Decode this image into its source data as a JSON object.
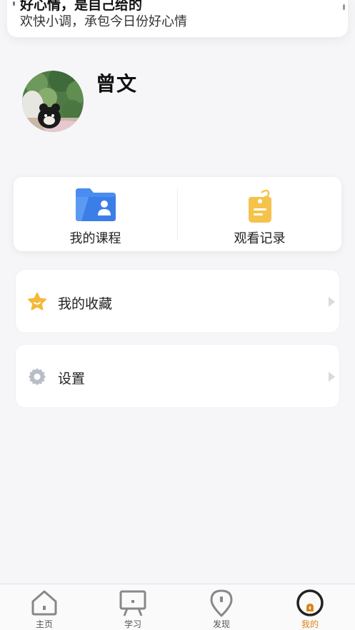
{
  "notification": {
    "title": "好心情，是自己给的",
    "body": "欢快小调，承包今日份好心情"
  },
  "profile": {
    "name": "曾文"
  },
  "quick_actions": [
    {
      "label": "我的课程",
      "icon": "folder-user-icon"
    },
    {
      "label": "观看记录",
      "icon": "tag-history-icon"
    }
  ],
  "menu": [
    {
      "label": "我的收藏",
      "icon": "star-icon"
    },
    {
      "label": "设置",
      "icon": "gear-icon"
    }
  ],
  "tabbar": {
    "items": [
      {
        "label": "主页",
        "icon": "home-icon"
      },
      {
        "label": "学习",
        "icon": "study-board-icon"
      },
      {
        "label": "发现",
        "icon": "location-pin-icon"
      },
      {
        "label": "我的",
        "icon": "profile-icon",
        "active": true
      }
    ]
  },
  "colors": {
    "accent": "#d9861a",
    "folder_blue": "#4a8cf0",
    "tag_yellow": "#f5c24b",
    "star_yellow": "#f3b93a",
    "gear_grey": "#b8bdc8"
  }
}
